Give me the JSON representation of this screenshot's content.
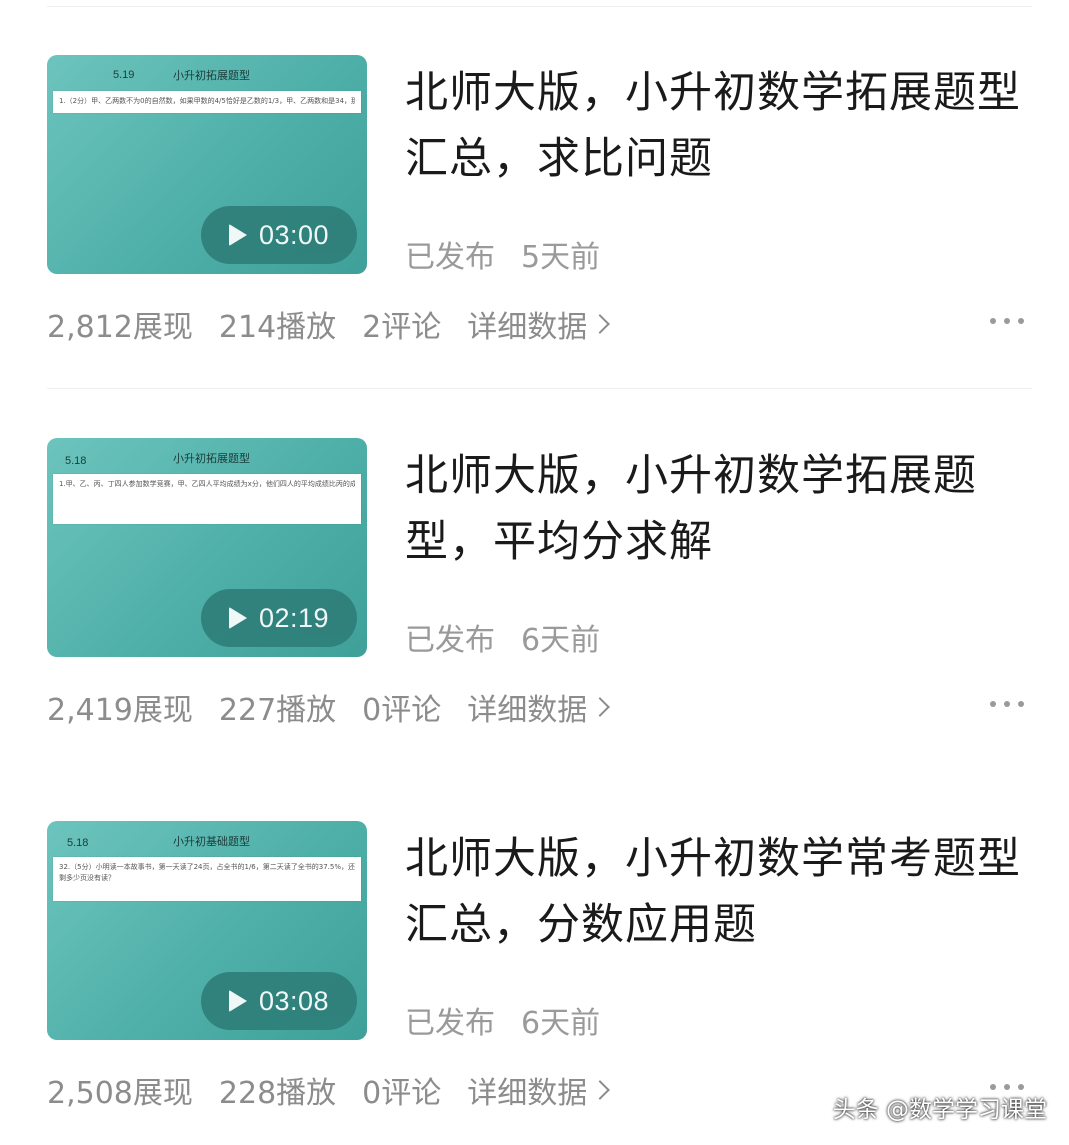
{
  "feed": {
    "items": [
      {
        "thumb_date": "5.19",
        "thumb_title": "小升初拓展题型",
        "thumb_text": "1.（2分）甲、乙两数不为0的自然数，如果甲数的4/5恰好是乙数的1/3，甲、乙两数和是34，那么甲、乙两数的差是____。",
        "duration": "03:00",
        "title": "北师大版，小升初数学拓展题型汇总，求比问题",
        "status": "已发布",
        "time": "5天前",
        "impressions": "2,812展现",
        "plays": "214播放",
        "comments": "2评论",
        "detail_label": "详细数据"
      },
      {
        "thumb_date": "5.18",
        "thumb_title": "小升初拓展题型",
        "thumb_text": "1.甲、乙、丙、丁四人参加数学竞赛，甲、乙四人平均成绩为x分，他们四人的平均成绩比丙的成绩多……",
        "duration": "02:19",
        "title": "北师大版，小升初数学拓展题型，平均分求解",
        "status": "已发布",
        "time": "6天前",
        "impressions": "2,419展现",
        "plays": "227播放",
        "comments": "0评论",
        "detail_label": "详细数据"
      },
      {
        "thumb_date": "5.18",
        "thumb_title": "小升初基础题型",
        "thumb_text": "32.（5分）小明读一本故事书，第一天读了24页，占全书的1/6，第二天读了全书的37.5%，还剩多少页没有读？",
        "duration": "03:08",
        "title": "北师大版，小升初数学常考题型汇总，分数应用题",
        "status": "已发布",
        "time": "6天前",
        "impressions": "2,508展现",
        "plays": "228播放",
        "comments": "0评论",
        "detail_label": "详细数据"
      }
    ]
  },
  "watermark": "头条 @数学学习课堂",
  "icons": {
    "play": "play-icon",
    "chevron": "chevron-right-icon",
    "more": "more-horizontal-icon"
  },
  "colors": {
    "thumbnail_teal": "#4fb0a9",
    "play_pill": "#2f7f7a",
    "title_text": "#1a1a1a",
    "meta_text": "#9a9a9a"
  }
}
